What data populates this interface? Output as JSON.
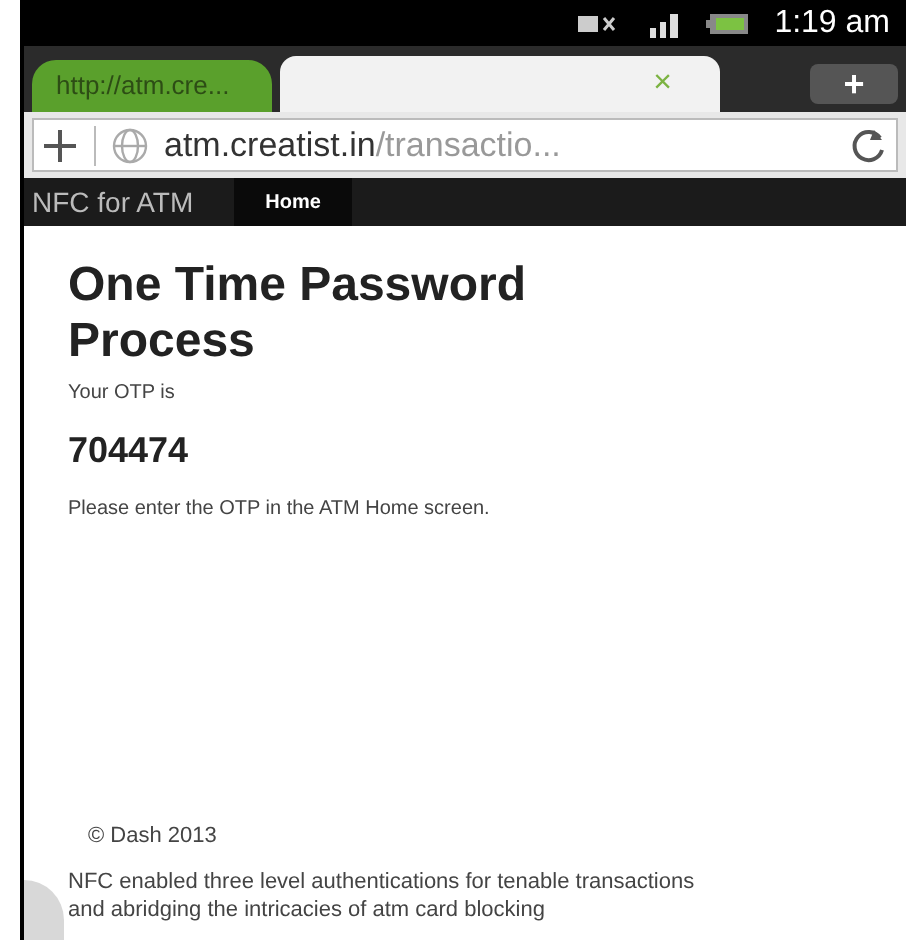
{
  "status_bar": {
    "time": "1:19 am"
  },
  "tabs": [
    {
      "label": "http://atm.cre...",
      "selected": false
    },
    {
      "selected": true,
      "close": "×"
    }
  ],
  "new_tab": "+",
  "address_bar": {
    "domain": "atm.creatist.in",
    "path": "/transactio..."
  },
  "navbar": {
    "brand": "NFC for ATM",
    "items": [
      {
        "label": "Home",
        "selected": true
      }
    ]
  },
  "page": {
    "title": "One Time Password Process",
    "otp_label": "Your OTP is",
    "otp": "704474",
    "instruction": "Please enter the OTP in the ATM Home screen."
  },
  "footer": {
    "copyright": "© Dash 2013",
    "tagline": "NFC enabled three level authentications for tenable transactions and abridging the intricacies of atm card blocking"
  }
}
